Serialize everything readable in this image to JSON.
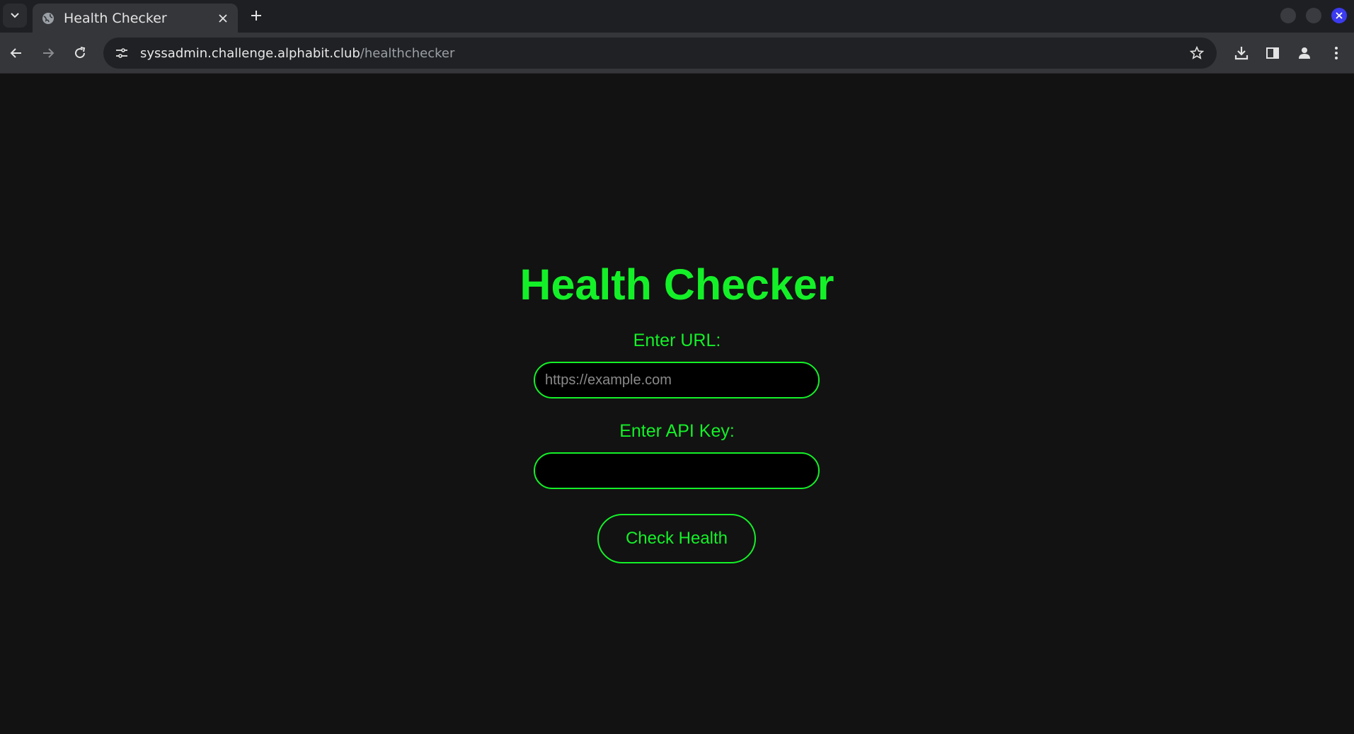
{
  "browser": {
    "tab_title": "Health Checker",
    "url_host": "syssadmin.challenge.alphabit.club",
    "url_path": "/healthchecker"
  },
  "page": {
    "title": "Health Checker",
    "url_label": "Enter URL:",
    "url_placeholder": "https://example.com",
    "url_value": "",
    "api_key_label": "Enter API Key:",
    "api_key_value": "",
    "submit_label": "Check Health"
  },
  "colors": {
    "accent": "#14f028",
    "background": "#121212",
    "input_background": "#000000"
  },
  "icons": {
    "tab_search": "chevron-down-icon",
    "favicon": "globe-icon",
    "tab_close": "close-icon",
    "new_tab": "plus-icon",
    "back": "arrow-left-icon",
    "forward": "arrow-right-icon",
    "reload": "reload-icon",
    "site_info": "tune-icon",
    "bookmark": "star-icon",
    "download": "download-icon",
    "side_panel": "side-panel-icon",
    "profile": "person-icon",
    "menu": "kebab-menu-icon"
  }
}
